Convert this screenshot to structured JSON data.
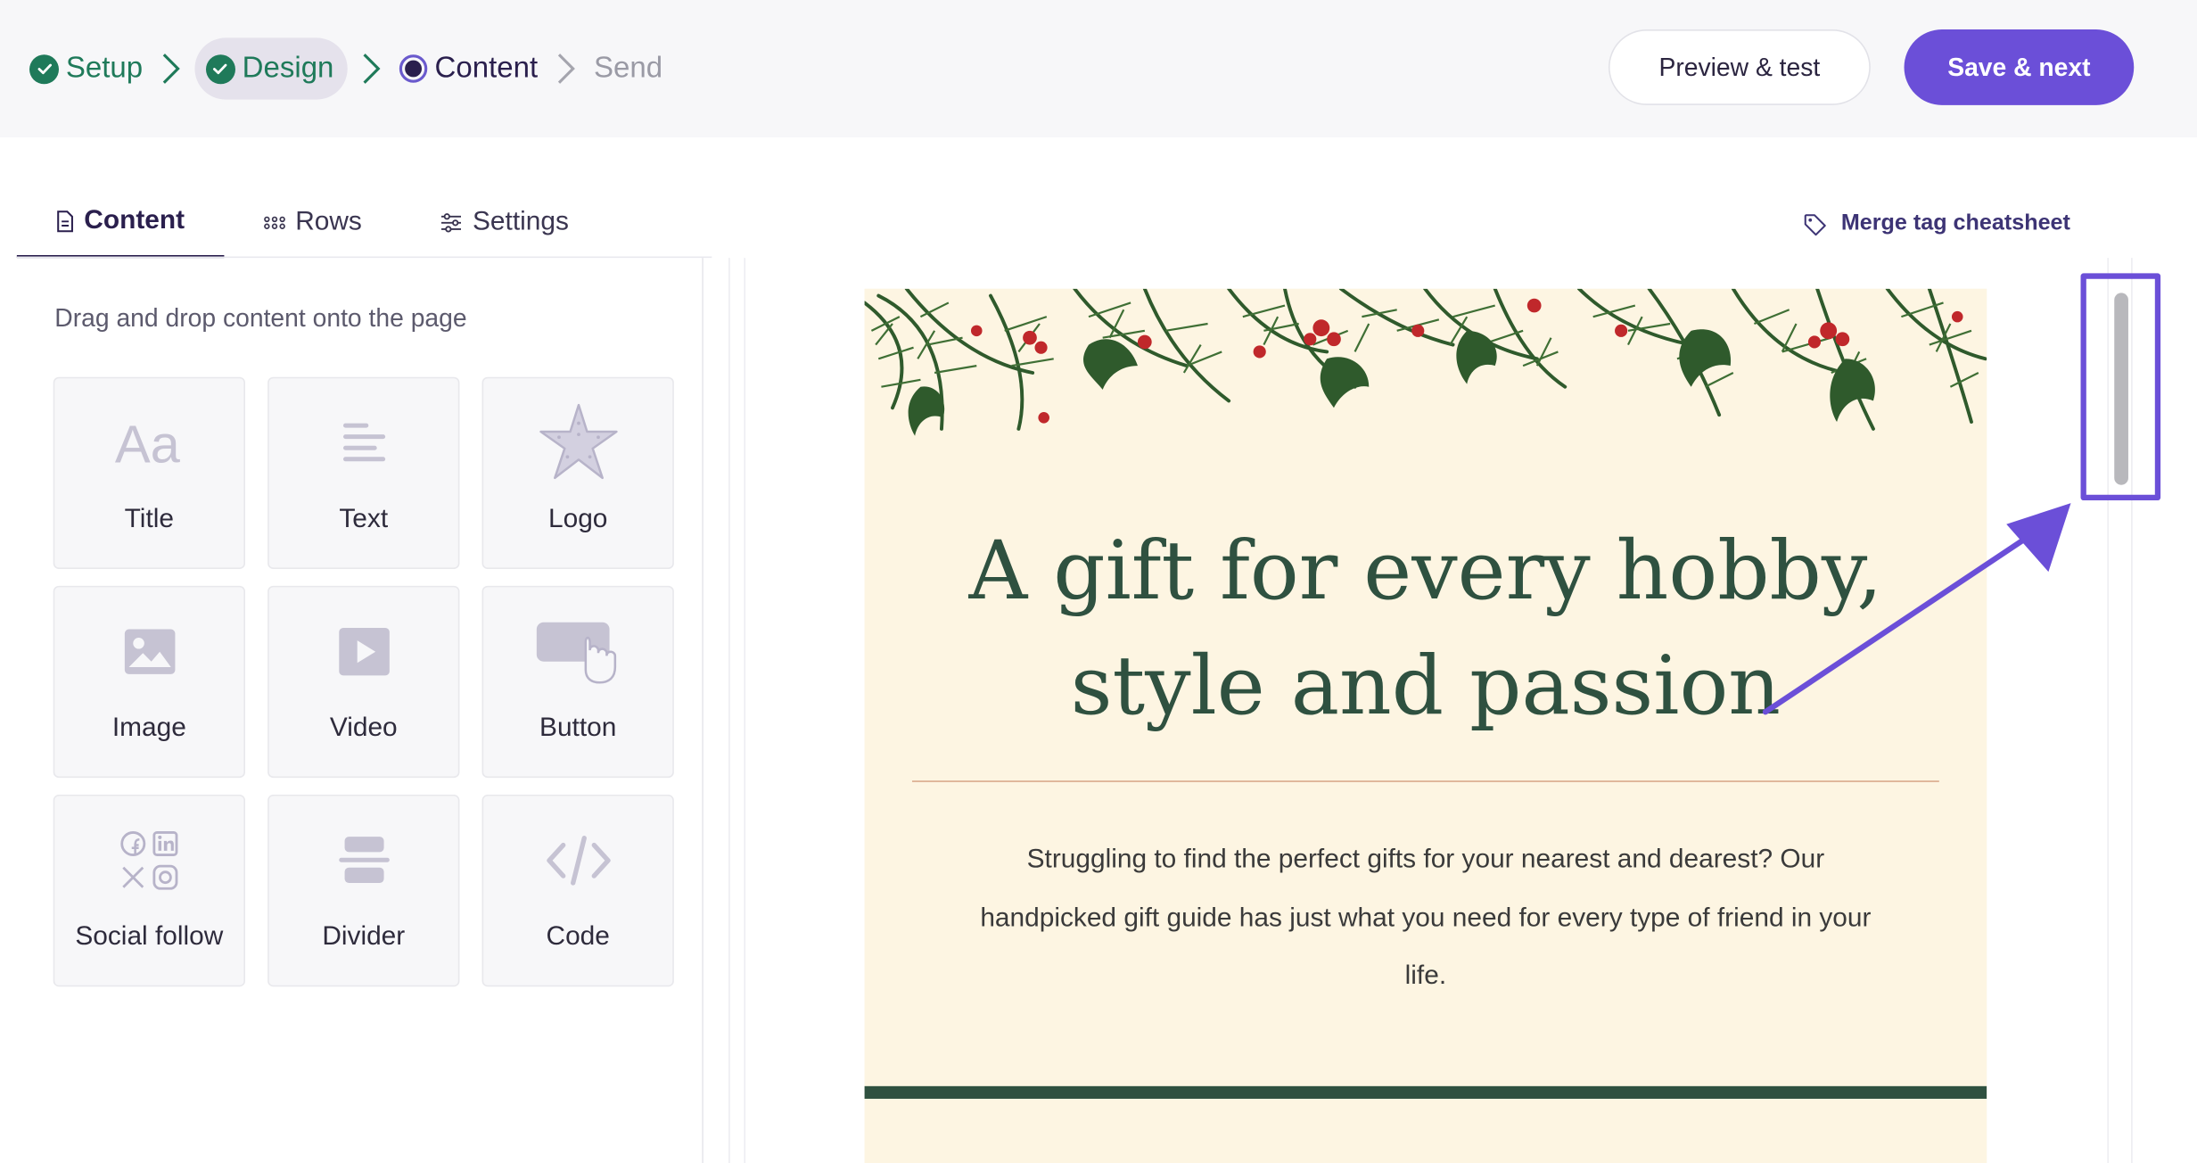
{
  "stepper": {
    "steps": [
      {
        "label": "Setup",
        "state": "done"
      },
      {
        "label": "Design",
        "state": "done"
      },
      {
        "label": "Content",
        "state": "current"
      },
      {
        "label": "Send",
        "state": "todo"
      }
    ]
  },
  "actions": {
    "preview_label": "Preview & test",
    "save_label": "Save & next"
  },
  "tabs": {
    "content": "Content",
    "rows": "Rows",
    "settings": "Settings"
  },
  "merge_tag_link": "Merge tag cheatsheet",
  "panel": {
    "hint": "Drag and drop content onto the page",
    "blocks": [
      {
        "label": "Title",
        "icon": "title-icon"
      },
      {
        "label": "Text",
        "icon": "text-lines-icon"
      },
      {
        "label": "Logo",
        "icon": "starfish-logo-icon"
      },
      {
        "label": "Image",
        "icon": "image-icon"
      },
      {
        "label": "Video",
        "icon": "video-play-icon"
      },
      {
        "label": "Button",
        "icon": "button-pointer-icon"
      },
      {
        "label": "Social follow",
        "icon": "social-icons"
      },
      {
        "label": "Divider",
        "icon": "divider-icon"
      },
      {
        "label": "Code",
        "icon": "code-brackets-icon"
      }
    ]
  },
  "email": {
    "title": "A gift for every hobby, style and passion",
    "body": "Struggling to find the perfect gifts for your nearest and dearest? Our handpicked gift guide has just what you need for every type of friend in your life."
  },
  "colors": {
    "accent": "#6b4fd8",
    "done_green": "#1f7a5a",
    "email_bg": "#fdf5e2",
    "email_heading": "#2f5140",
    "email_rule": "#d9a88a"
  }
}
